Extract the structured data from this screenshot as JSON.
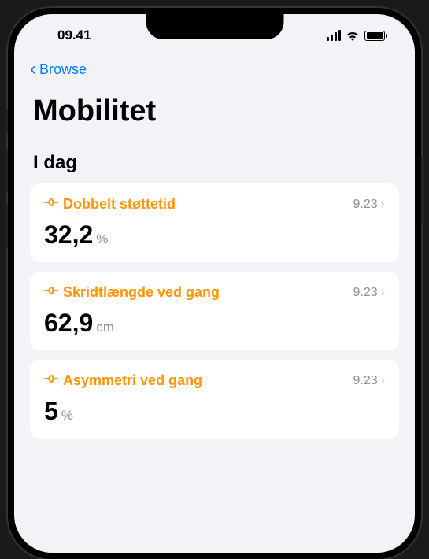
{
  "statusBar": {
    "time": "09.41"
  },
  "nav": {
    "backLabel": "Browse"
  },
  "page": {
    "title": "Mobilitet",
    "sectionHeader": "I dag"
  },
  "cards": [
    {
      "title": "Dobbelt støttetid",
      "time": "9.23",
      "value": "32,2",
      "unit": "%"
    },
    {
      "title": "Skridtlængde ved gang",
      "time": "9.23",
      "value": "62,9",
      "unit": "cm"
    },
    {
      "title": "Asymmetri ved gang",
      "time": "9.23",
      "value": "5",
      "unit": "%"
    }
  ]
}
